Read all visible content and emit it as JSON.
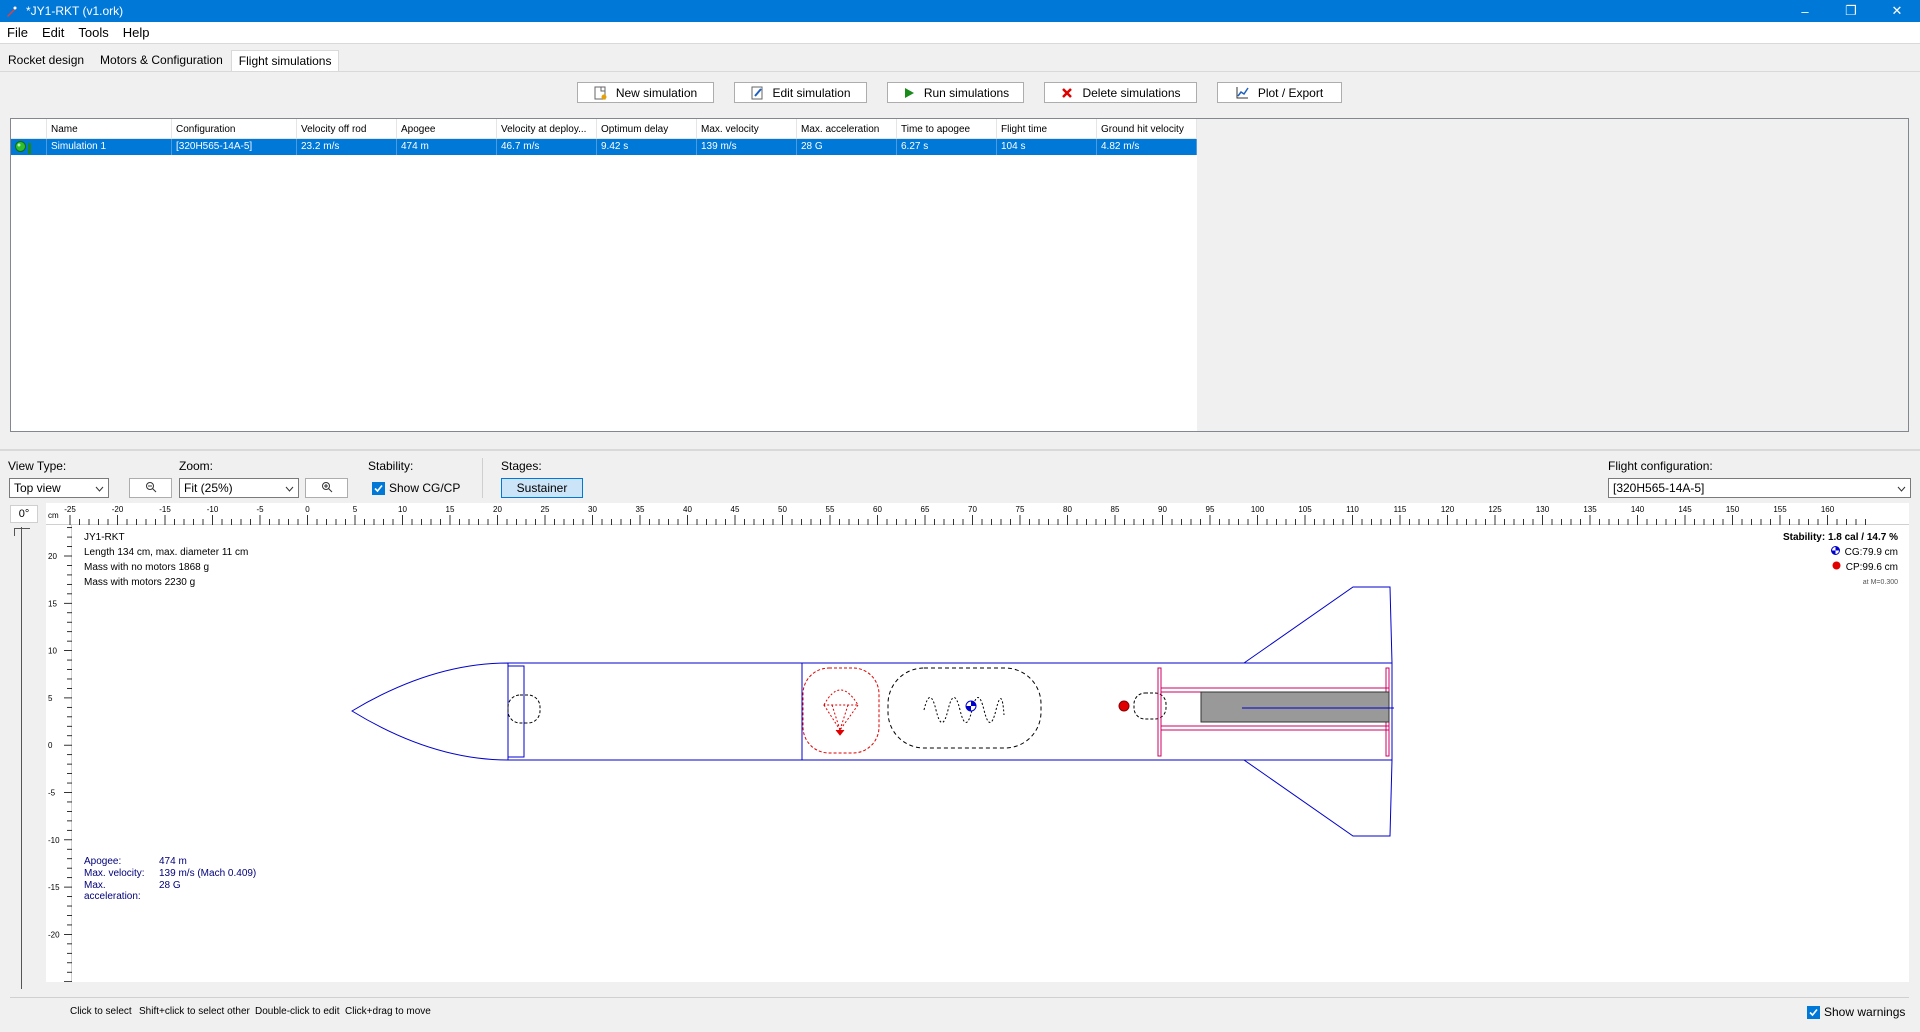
{
  "window": {
    "title": "*JY1-RKT (v1.ork)",
    "controls": {
      "minimize": "–",
      "maximize": "❐",
      "close": "✕"
    }
  },
  "menu": [
    "File",
    "Edit",
    "Tools",
    "Help"
  ],
  "tabs": [
    {
      "label": "Rocket design",
      "active": false
    },
    {
      "label": "Motors & Configuration",
      "active": false
    },
    {
      "label": "Flight simulations",
      "active": true
    }
  ],
  "toolbar": {
    "new_sim": "New simulation",
    "edit_sim": "Edit simulation",
    "run_sims": "Run simulations",
    "delete_sims": "Delete simulations",
    "plot_export": "Plot / Export"
  },
  "table": {
    "headers": [
      "",
      "Name",
      "Configuration",
      "Velocity off rod",
      "Apogee",
      "Velocity at deploy...",
      "Optimum delay",
      "Max. velocity",
      "Max. acceleration",
      "Time to apogee",
      "Flight time",
      "Ground hit velocity"
    ],
    "rows": [
      [
        "",
        "Simulation 1",
        "[320H565-14A-5]",
        "23.2 m/s",
        "474 m",
        "46.7 m/s",
        "9.42 s",
        "139 m/s",
        "28 G",
        "6.27 s",
        "104 s",
        "4.82 m/s"
      ]
    ]
  },
  "controls": {
    "view_type_label": "View Type:",
    "view_type_value": "Top view",
    "zoom_label": "Zoom:",
    "zoom_value": "Fit (25%)",
    "stability_label": "Stability:",
    "show_cgcp_label": "Show CG/CP",
    "stages_label": "Stages:",
    "stage_button": "Sustainer",
    "flight_config_label": "Flight configuration:",
    "flight_config_value": "[320H565-14A-5]",
    "rotation_label": "0°",
    "ruler_unit": "cm"
  },
  "ruler": {
    "x_labels": [
      "-25",
      "-20",
      "-15",
      "-10",
      "-5",
      "0",
      "5",
      "10",
      "15",
      "20",
      "25",
      "30",
      "35",
      "40",
      "45",
      "50",
      "55",
      "60",
      "65",
      "70",
      "75",
      "80",
      "85",
      "90",
      "95",
      "100",
      "105",
      "110",
      "115",
      "120",
      "125",
      "130",
      "135",
      "140",
      "145",
      "150",
      "155",
      "160"
    ],
    "y_labels": [
      "20",
      "15",
      "10",
      "5",
      "0",
      "-5",
      "-10",
      "-15",
      "-20"
    ]
  },
  "rocket_info": {
    "name": "JY1-RKT",
    "length": "Length 134 cm, max. diameter 11 cm",
    "mass_no_motors": "Mass with no motors 1868 g",
    "mass_with_motors": "Mass with motors 2230 g"
  },
  "stability_info": {
    "stability": "Stability: 1.8 cal / 14.7 %",
    "cg": "CG:79.9 cm",
    "cp": "CP:99.6 cm",
    "mach": "at M=0.300"
  },
  "flight_stats": {
    "apogee_label": "Apogee:",
    "apogee_value": "474 m",
    "max_vel_label": "Max. velocity:",
    "max_vel_value": "139 m/s  (Mach 0.409)",
    "max_acc_label": "Max. acceleration:",
    "max_acc_value": "28 G"
  },
  "status_hints": [
    "Click to select",
    "Shift+click to select other",
    "Double-click to edit",
    "Click+drag to move"
  ],
  "show_warnings_label": "Show warnings",
  "colors": {
    "accent": "#0078d7",
    "rocket_outline": "#0000cc",
    "parachute": "#e00000",
    "motor_mount": "#cc0066",
    "motor": "#999999"
  }
}
